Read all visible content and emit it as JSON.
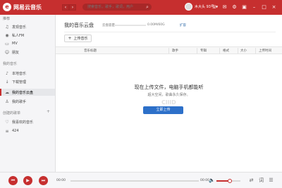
{
  "app": {
    "logo_mark": "e",
    "title": "网易云音乐"
  },
  "topbar": {
    "back_icon": "‹",
    "forward_icon": "›",
    "search_placeholder": "搜索音乐，歌手，歌词，用户",
    "username": "木大头 93号",
    "icons": [
      "shirt-icon",
      "mail-icon",
      "settings-icon",
      "mini-mode-icon",
      "minimize-icon",
      "maximize-icon",
      "close-icon"
    ]
  },
  "sidebar": {
    "recommend_title": "推荐",
    "recommend_items": [
      {
        "name": "discover",
        "icon": "♫",
        "label": "发现音乐"
      },
      {
        "name": "personal-fm",
        "icon": "◉",
        "label": "私人FM"
      },
      {
        "name": "mv",
        "icon": "▭",
        "label": "MV"
      },
      {
        "name": "friends",
        "icon": "☺",
        "label": "朋友"
      }
    ],
    "my_music_title": "我的音乐",
    "my_music_items": [
      {
        "name": "local-music",
        "icon": "♪",
        "label": "本地音乐",
        "active": false
      },
      {
        "name": "downloads",
        "icon": "↓",
        "label": "下载管理",
        "active": false
      },
      {
        "name": "music-cloud",
        "icon": "☁",
        "label": "我的音乐云盘",
        "active": true
      },
      {
        "name": "my-singers",
        "icon": "♙",
        "label": "我的歌手",
        "active": false
      }
    ],
    "created_title": "创建的歌单",
    "add_label": "+",
    "playlists": [
      {
        "name": "liked-music",
        "icon": "♡",
        "label": "我喜欢的音乐"
      },
      {
        "name": "playlist-424",
        "icon": "≡",
        "label": "424"
      }
    ]
  },
  "main": {
    "title": "我的音乐云盘",
    "capacity_label": "云盘容量",
    "capacity_text": "0.00M/60G",
    "capacity_fraction": 0,
    "expand_label": "扩容",
    "upload_label": "上传音乐",
    "columns": [
      "音乐标题",
      "歌手",
      "专辑",
      "格式",
      "大小",
      "上传时间"
    ],
    "empty_title": "现在上传文件，电脑手机都能听",
    "empty_sub": "超大空间，歌曲永久保存。",
    "upload_main_label": "立即上传",
    "watermark": "ClllD"
  },
  "player": {
    "prev_icon": "⏮",
    "play_icon": "▶",
    "next_icon": "⏭",
    "current_time": "00:00",
    "total_time": "00:00",
    "progress_fraction": 0,
    "volume_fraction": 0.55,
    "volume_icon": "🔈",
    "mode_icon": "⇄",
    "playlist_icon": "☰",
    "lyrics_icon": "词"
  }
}
